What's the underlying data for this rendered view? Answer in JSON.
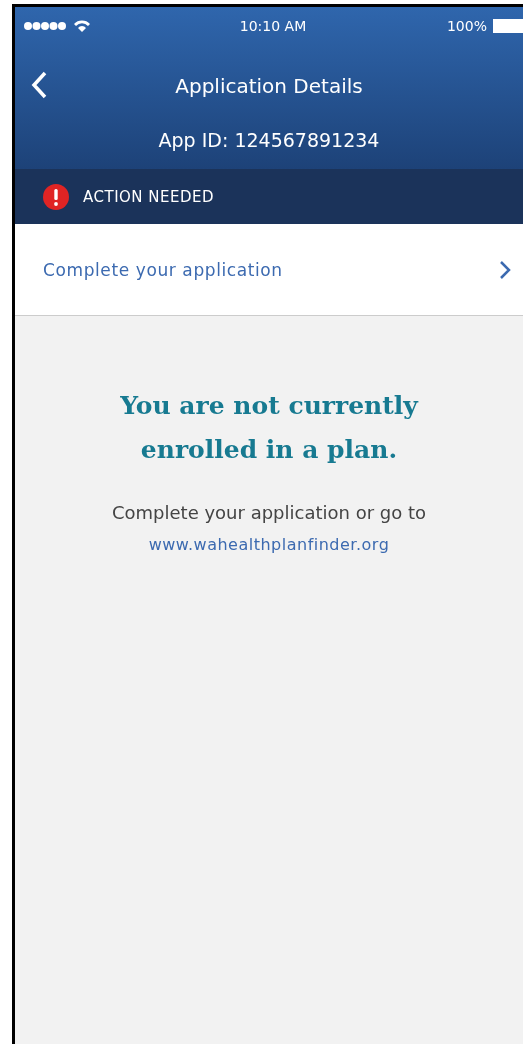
{
  "status_bar": {
    "time": "10:10 AM",
    "battery": "100%"
  },
  "nav": {
    "title": "Application Details",
    "subtitle": "App ID: 124567891234"
  },
  "alert": {
    "label": "ACTION NEEDED"
  },
  "rows": [
    {
      "label": "Complete your application"
    }
  ],
  "empty_state": {
    "heading": "You are not currently enrolled in a plan.",
    "message": "Complete your application or go to",
    "link": "www.wahealthplanfinder.org"
  }
}
